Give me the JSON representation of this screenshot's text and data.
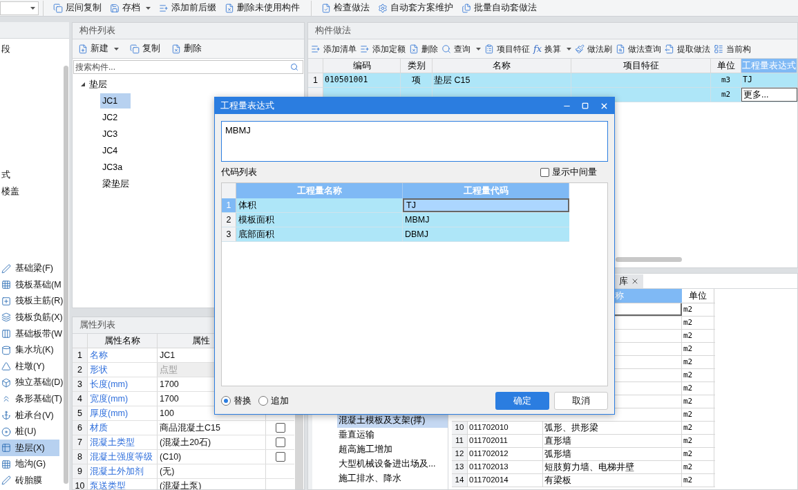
{
  "toolbar": {
    "groups": [
      [
        {
          "label": "层间复制",
          "has_menu": false
        },
        {
          "label": "存档",
          "has_menu": true
        },
        {
          "label": "添加前后缀",
          "has_menu": false
        },
        {
          "label": "删除未使用构件",
          "has_menu": false
        }
      ],
      [
        {
          "label": "检查做法",
          "has_menu": false
        },
        {
          "label": "自动套方案维护",
          "has_menu": false
        },
        {
          "label": "批量自动套做法",
          "has_menu": false
        }
      ]
    ]
  },
  "sidebar": {
    "items": [
      {
        "label": "段",
        "kind": "text",
        "selected": false
      },
      {
        "label": "式",
        "kind": "text",
        "selected": false
      },
      {
        "label": "楼盖",
        "kind": "text",
        "selected": false
      },
      {
        "label": "基础梁(F)",
        "kind": "icon",
        "selected": false
      },
      {
        "label": "筏板基础(M",
        "kind": "icon",
        "selected": false
      },
      {
        "label": "筏板主筋(R)",
        "kind": "icon",
        "selected": false
      },
      {
        "label": "筏板负筋(X)",
        "kind": "icon",
        "selected": false
      },
      {
        "label": "基础板带(W",
        "kind": "icon",
        "selected": false
      },
      {
        "label": "集水坑(K)",
        "kind": "icon",
        "selected": false
      },
      {
        "label": "柱墩(Y)",
        "kind": "icon",
        "selected": false
      },
      {
        "label": "独立基础(D)",
        "kind": "icon",
        "selected": false
      },
      {
        "label": "条形基础(T)",
        "kind": "icon",
        "selected": false
      },
      {
        "label": "桩承台(V)",
        "kind": "icon",
        "selected": false
      },
      {
        "label": "桩(U)",
        "kind": "icon",
        "selected": false
      },
      {
        "label": "垫层(X)",
        "kind": "icon",
        "selected": true
      },
      {
        "label": "地沟(G)",
        "kind": "icon",
        "selected": false
      },
      {
        "label": "砖胎膜",
        "kind": "icon",
        "selected": false
      }
    ]
  },
  "component_list": {
    "title": "构件列表",
    "toolbar": [
      {
        "label": "新建",
        "has_menu": true
      },
      {
        "label": "复制",
        "has_menu": false
      },
      {
        "label": "删除",
        "has_menu": false
      }
    ],
    "search": {
      "placeholder": "搜索构件..."
    },
    "tree": [
      {
        "label": "垫层",
        "expanded": true,
        "selected": false,
        "children": [
          {
            "label": "JC1",
            "selected": true
          },
          {
            "label": "JC2",
            "selected": false
          },
          {
            "label": "JC3",
            "selected": false
          },
          {
            "label": "JC4",
            "selected": false
          },
          {
            "label": "JC3a",
            "selected": false
          },
          {
            "label": "梁垫层",
            "selected": false
          }
        ]
      }
    ]
  },
  "properties": {
    "title": "属性列表",
    "columns": [
      "属性名称",
      "属性"
    ],
    "rows": [
      {
        "num": "1",
        "name": "名称",
        "value": "JC1",
        "disabled": false
      },
      {
        "num": "2",
        "name": "形状",
        "value": "点型",
        "disabled": true
      },
      {
        "num": "3",
        "name": "长度(mm)",
        "value": "1700",
        "disabled": false
      },
      {
        "num": "4",
        "name": "宽度(mm)",
        "value": "1700",
        "disabled": false
      },
      {
        "num": "5",
        "name": "厚度(mm)",
        "value": "100",
        "disabled": false
      },
      {
        "num": "6",
        "name": "材质",
        "value": "商品混凝土C15",
        "disabled": false,
        "checked": false
      },
      {
        "num": "7",
        "name": "混凝土类型",
        "value": "(混凝土20石)",
        "disabled": false,
        "checked": false
      },
      {
        "num": "8",
        "name": "混凝土强度等级",
        "value": "(C10)",
        "disabled": false,
        "checked": false
      },
      {
        "num": "9",
        "name": "混凝土外加剂",
        "value": "(无)",
        "disabled": false
      },
      {
        "num": "10",
        "name": "泵送类型",
        "value": "(混凝土泵)",
        "disabled": false
      }
    ]
  },
  "method": {
    "title": "构件做法",
    "toolbar": [
      {
        "label": "添加清单",
        "has_menu": false
      },
      {
        "label": "添加定额",
        "has_menu": false
      },
      {
        "label": "删除",
        "has_menu": false
      },
      {
        "label": "查询",
        "has_menu": true
      },
      {
        "label": "项目特征",
        "has_menu": false
      },
      {
        "label": "换算",
        "glyph": "fx",
        "has_menu": true
      },
      {
        "label": "做法刷",
        "has_menu": false
      },
      {
        "label": "做法查询",
        "has_menu": false
      },
      {
        "label": "提取做法",
        "has_menu": false
      },
      {
        "label": "当前构",
        "has_menu": false
      }
    ],
    "columns": [
      "编码",
      "类别",
      "名称",
      "项目特征",
      "单位",
      "工程量表达式"
    ],
    "rows": [
      {
        "num": "1",
        "code": "010501001",
        "type": "项",
        "name": "垫层 C15",
        "unit": "m3",
        "expr": "TJ",
        "editing": false
      },
      {
        "unit": "m2",
        "expr": "更多...",
        "editing": true
      }
    ]
  },
  "library": {
    "tab": {
      "label": "库",
      "closable": true
    },
    "tree": [
      {
        "label": "混凝土模板及支架(撑)",
        "selected": true
      },
      {
        "label": "垂直运输",
        "selected": false
      },
      {
        "label": "超高施工增加",
        "selected": false
      },
      {
        "label": "大型机械设备进出场及...",
        "selected": false
      },
      {
        "label": "施工排水、降水",
        "selected": false
      }
    ],
    "columns": [
      "称",
      "单位"
    ],
    "rows": [
      {
        "unit": "m2",
        "selected": true
      },
      {
        "unit": "m2",
        "selected": false
      },
      {
        "unit": "m2",
        "selected": false
      },
      {
        "unit": "m2",
        "selected": false
      },
      {
        "unit": "m2",
        "selected": false
      },
      {
        "unit": "m2",
        "selected": false
      },
      {
        "unit": "m2",
        "selected": false
      },
      {
        "unit": "m2",
        "selected": false
      },
      {
        "unit": "m2",
        "selected": false
      },
      {
        "num": "10",
        "code": "011702010",
        "name": "弧形、拱形梁",
        "unit": "m2",
        "selected": false
      },
      {
        "num": "11",
        "code": "011702011",
        "name": "直形墙",
        "unit": "m2",
        "selected": false
      },
      {
        "num": "12",
        "code": "011702012",
        "name": "弧形墙",
        "unit": "m2",
        "selected": false
      },
      {
        "num": "13",
        "code": "011702013",
        "name": "短肢剪力墙、电梯井壁",
        "unit": "m2",
        "selected": false
      },
      {
        "num": "14",
        "code": "011702014",
        "name": "有梁板",
        "unit": "m2",
        "selected": false
      }
    ]
  },
  "dialog": {
    "title": "工程量表达式",
    "expression": "MBMJ",
    "list_label": "代码列表",
    "show_intermediate": {
      "label": "显示中间量",
      "checked": false
    },
    "columns": [
      "工程量名称",
      "工程量代码"
    ],
    "rows": [
      {
        "num": "1",
        "name": "体积",
        "code": "TJ",
        "selected": true
      },
      {
        "num": "2",
        "name": "模板面积",
        "code": "MBMJ",
        "selected": false
      },
      {
        "num": "3",
        "name": "底部面积",
        "code": "DBMJ",
        "selected": false
      }
    ],
    "mode": [
      {
        "label": "替换",
        "selected": true
      },
      {
        "label": "追加",
        "selected": false
      }
    ],
    "buttons": [
      {
        "label": "确定",
        "primary": true
      },
      {
        "label": "取消",
        "primary": false
      }
    ]
  }
}
